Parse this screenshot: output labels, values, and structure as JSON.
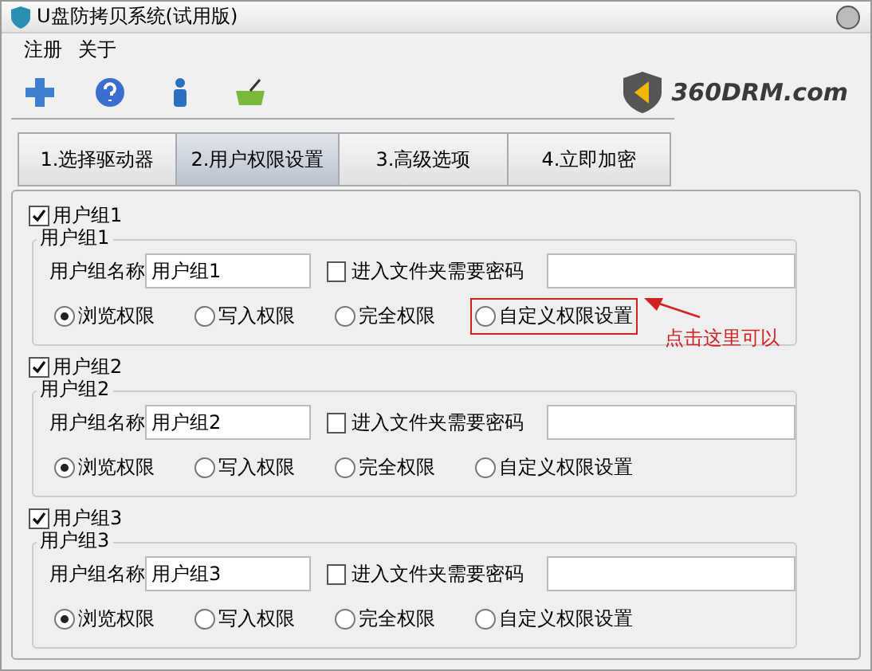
{
  "window": {
    "title": "U盘防拷贝系统(试用版)"
  },
  "menu": [
    "注册",
    "关于"
  ],
  "logo": {
    "text": "360DRM.com"
  },
  "tabs": [
    {
      "label": "1.选择驱动器",
      "selected": false
    },
    {
      "label": "2.用户权限设置",
      "selected": true
    },
    {
      "label": "3.高级选项",
      "selected": false
    },
    {
      "label": "4.立即加密",
      "selected": false
    }
  ],
  "groups": [
    {
      "label": "用户组1",
      "checked": true,
      "legend": "用户组1",
      "name_label": "用户组名称",
      "name_value": "用户组1",
      "password_label": "进入文件夹需要密码",
      "password_checked": false,
      "options": [
        {
          "label": "浏览权限",
          "selected": true,
          "highlighted": false
        },
        {
          "label": "写入权限",
          "selected": false,
          "highlighted": false
        },
        {
          "label": "完全权限",
          "selected": false,
          "highlighted": false
        },
        {
          "label": "自定义权限设置",
          "selected": false,
          "highlighted": true
        }
      ],
      "annotation": "点击这里可以"
    },
    {
      "label": "用户组2",
      "checked": true,
      "legend": "用户组2",
      "name_label": "用户组名称",
      "name_value": "用户组2",
      "password_label": "进入文件夹需要密码",
      "password_checked": false,
      "options": [
        {
          "label": "浏览权限",
          "selected": true,
          "highlighted": false
        },
        {
          "label": "写入权限",
          "selected": false,
          "highlighted": false
        },
        {
          "label": "完全权限",
          "selected": false,
          "highlighted": false
        },
        {
          "label": "自定义权限设置",
          "selected": false,
          "highlighted": false
        }
      ]
    },
    {
      "label": "用户组3",
      "checked": true,
      "legend": "用户组3",
      "name_label": "用户组名称",
      "name_value": "用户组3",
      "password_label": "进入文件夹需要密码",
      "password_checked": false,
      "options": [
        {
          "label": "浏览权限",
          "selected": true,
          "highlighted": false
        },
        {
          "label": "写入权限",
          "selected": false,
          "highlighted": false
        },
        {
          "label": "完全权限",
          "selected": false,
          "highlighted": false
        },
        {
          "label": "自定义权限设置",
          "selected": false,
          "highlighted": false
        }
      ]
    }
  ]
}
